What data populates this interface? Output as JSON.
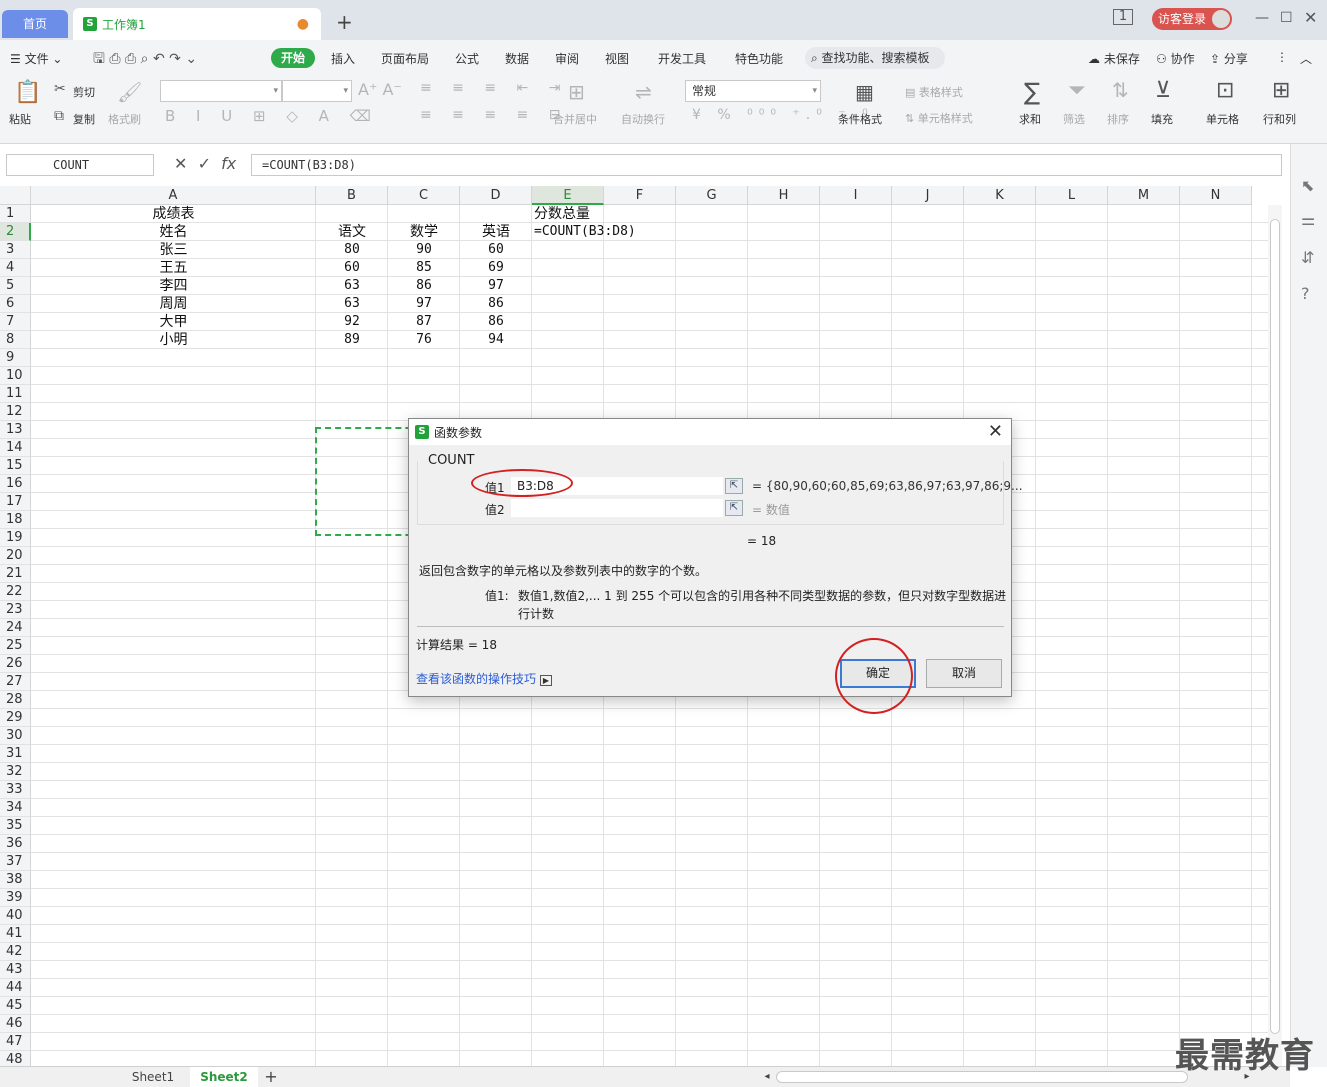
{
  "titlebar": {
    "home_tab": "首页",
    "doc_tab": "工作簿1",
    "login_button": "访客登录"
  },
  "menu": {
    "file": "文件",
    "start": "开始",
    "items": [
      "插入",
      "页面布局",
      "公式",
      "数据",
      "审阅",
      "视图",
      "开发工具",
      "特色功能"
    ],
    "search": "查找功能、搜索模板",
    "unsaved": "未保存",
    "collab": "协作",
    "share": "分享"
  },
  "ribbon": {
    "paste": "粘贴",
    "cut": "剪切",
    "copy": "复制",
    "format_painter": "格式刷",
    "number_format": "常规",
    "merge_center": "合并居中",
    "wrap_text": "自动换行",
    "cond_format": "条件格式",
    "table_style": "表格样式",
    "cell_style": "单元格样式",
    "sum": "求和",
    "filter": "筛选",
    "sort": "排序",
    "fill": "填充",
    "cell": "单元格",
    "row_col": "行和列"
  },
  "formula_bar": {
    "name_box": "COUNT",
    "formula": "=COUNT(B3:D8)"
  },
  "grid": {
    "columns": [
      "A",
      "B",
      "C",
      "D",
      "E",
      "F",
      "G",
      "H",
      "I",
      "J",
      "K",
      "L",
      "M",
      "N"
    ],
    "selected_column": "E",
    "selected_row": 2,
    "row_count": 48,
    "cells": {
      "A1": "成绩表",
      "A2": "姓名",
      "B2": "语文",
      "C2": "数学",
      "D2": "英语",
      "E1": "分数总量",
      "E2": "=COUNT(B3:D8)"
    },
    "students": [
      {
        "name": "张三",
        "chinese": "80",
        "math": "90",
        "english": "60"
      },
      {
        "name": "王五",
        "chinese": "60",
        "math": "85",
        "english": "69"
      },
      {
        "name": "李四",
        "chinese": "63",
        "math": "86",
        "english": "97"
      },
      {
        "name": "周周",
        "chinese": "63",
        "math": "97",
        "english": "86"
      },
      {
        "name": "大甲",
        "chinese": "92",
        "math": "87",
        "english": "86"
      },
      {
        "name": "小明",
        "chinese": "89",
        "math": "76",
        "english": "94"
      }
    ]
  },
  "sheets": {
    "tabs": [
      "Sheet1",
      "Sheet2"
    ],
    "active": "Sheet2"
  },
  "dialog": {
    "title": "函数参数",
    "function_name": "COUNT",
    "arg1_label": "值1",
    "arg1_value": "B3:D8",
    "arg1_result": "= {80,90,60;60,85,69;63,86,97;63,97,86;9...",
    "arg2_label": "值2",
    "arg2_value": "",
    "arg2_result": "= 数值",
    "overall_result": "=  18",
    "description": "返回包含数字的单元格以及参数列表中的数字的个数。",
    "arg_help_label": "值1:",
    "arg_help_line1": "数值1,数值2,... 1 到 255 个可以包含的引用各种不同类型数据的参数，但只对数字型数据进",
    "arg_help_line2": "行计数",
    "calc_result": "计算结果  =  18",
    "help_link": "查看该函数的操作技巧",
    "ok": "确定",
    "cancel": "取消"
  },
  "watermark": "最需教育"
}
